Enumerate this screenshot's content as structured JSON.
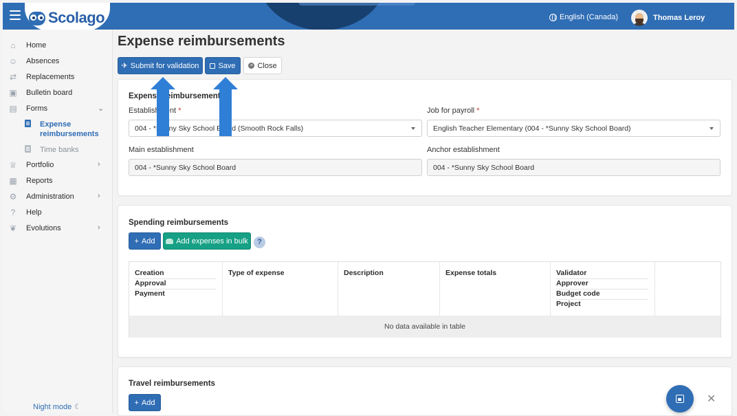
{
  "app": {
    "logo_text": "Scolago",
    "language": "English (Canada)",
    "user_name": "Thomas Leroy"
  },
  "sidebar": {
    "items": [
      {
        "label": "Home",
        "icon": "home-icon"
      },
      {
        "label": "Absences",
        "icon": "absences-icon"
      },
      {
        "label": "Replacements",
        "icon": "replacements-icon"
      },
      {
        "label": "Bulletin board",
        "icon": "bulletin-icon"
      },
      {
        "label": "Forms",
        "icon": "forms-icon"
      },
      {
        "label": "Portfolio",
        "icon": "trophy-icon"
      },
      {
        "label": "Reports",
        "icon": "reports-icon"
      },
      {
        "label": "Administration",
        "icon": "gear-icon"
      },
      {
        "label": "Help",
        "icon": "question-icon"
      },
      {
        "label": "Evolutions",
        "icon": "sprout-icon"
      }
    ],
    "forms_children": [
      {
        "label_line1": "Expense",
        "label_line2": "reimbursements",
        "active": true
      },
      {
        "label_line1": "Time banks",
        "active": false
      }
    ],
    "night_mode": "Night mode"
  },
  "page": {
    "title": "Expense reimbursements"
  },
  "toolbar": {
    "submit_label": "Submit for validation",
    "save_label": "Save",
    "close_label": "Close"
  },
  "expense_card": {
    "title": "Expense reimbursement",
    "establishment_label": "Establishment",
    "establishment_value": "004 - *Sunny Sky School Board (Smooth Rock Falls)",
    "job_label": "Job for payroll",
    "job_value": "English Teacher Elementary (004 - *Sunny Sky School Board)",
    "main_est_label": "Main establishment",
    "main_est_value": "004 - *Sunny Sky School Board",
    "anchor_est_label": "Anchor establishment",
    "anchor_est_value": "004 - *Sunny Sky School Board"
  },
  "spending_card": {
    "title": "Spending reimbursements",
    "add_label": "Add",
    "bulk_label": "Add expenses in bulk",
    "help": "?",
    "columns": {
      "c1": [
        "Creation",
        "Approval",
        "Payment"
      ],
      "c2": "Type of expense",
      "c3": "Description",
      "c4": "Expense totals",
      "c5": [
        "Validator",
        "Approver",
        "Budget code",
        "Project"
      ]
    },
    "empty_text": "No data available in table"
  },
  "travel_card": {
    "title": "Travel reimbursements",
    "add_label": "Add"
  },
  "colors": {
    "primary": "#2f6db4",
    "teal": "#16a085",
    "arrow": "#2f7fd6"
  }
}
